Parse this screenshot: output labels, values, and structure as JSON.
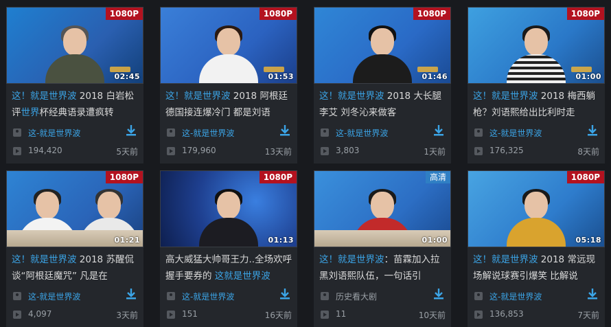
{
  "colors": {
    "accent": "#3ba4e6",
    "badge": "#b3121f",
    "badge_hd": "#2f7fc4",
    "background": "#181a1e",
    "card": "#24272c"
  },
  "videos": [
    {
      "badge": "1080P",
      "duration": "02:45",
      "title_hl1": "这！就是世界波",
      "title_plain1": " 2018 白岩松评",
      "title_hl2": "世界",
      "title_plain2": "杯经典语录遭疯转",
      "uploader": "这-就是世界波",
      "views": "194,420",
      "age": "5天前"
    },
    {
      "badge": "1080P",
      "duration": "01:53",
      "title_hl1": "这！就是世界波",
      "title_plain1": " 2018 阿根廷德国接连爆冷门 都是刘语",
      "title_hl2": "",
      "title_plain2": "",
      "uploader": "这-就是世界波",
      "views": "179,960",
      "age": "13天前"
    },
    {
      "badge": "1080P",
      "duration": "01:46",
      "title_hl1": "这！就是世界波",
      "title_plain1": " 2018 大长腿李艾 刘冬沁来做客",
      "title_hl2": "",
      "title_plain2": "",
      "uploader": "这-就是世界波",
      "views": "3,803",
      "age": "1天前"
    },
    {
      "badge": "1080P",
      "duration": "01:00",
      "title_hl1": "这！就是世界波",
      "title_plain1": " 2018 梅西躺枪？刘语熙给出比利时走",
      "title_hl2": "",
      "title_plain2": "",
      "uploader": "这-就是世界波",
      "views": "176,325",
      "age": "8天前"
    },
    {
      "badge": "1080P",
      "duration": "01:21",
      "title_hl1": "这！就是世界波",
      "title_plain1": " 2018 苏醒侃谈“阿根廷魔咒” 凡是在",
      "title_hl2": "",
      "title_plain2": "",
      "uploader": "这-就是世界波",
      "views": "4,097",
      "age": "3天前"
    },
    {
      "badge": "1080P",
      "duration": "01:13",
      "title_hl1": "",
      "title_plain1": "高大威猛大帅哥王力..全场欢呼 握手要券的 ",
      "title_hl2": "这就是世界波",
      "title_plain2": "",
      "uploader": "这-就是世界波",
      "views": "151",
      "age": "16天前"
    },
    {
      "badge": "高清",
      "duration": "01:00",
      "title_hl1": "这！就是世界波",
      "title_plain1": "：苗霖加入拉黑刘语熙队伍，一句话引",
      "title_hl2": "",
      "title_plain2": "",
      "uploader": "历史看大剧",
      "views": "11",
      "age": "10天前"
    },
    {
      "badge": "1080P",
      "duration": "05:18",
      "title_hl1": "这！就是世界波",
      "title_plain1": " 2018 常远现场解说球赛引爆笑 比解说",
      "title_hl2": "",
      "title_plain2": "",
      "uploader": "这-就是世界波",
      "views": "136,853",
      "age": "7天前"
    }
  ]
}
